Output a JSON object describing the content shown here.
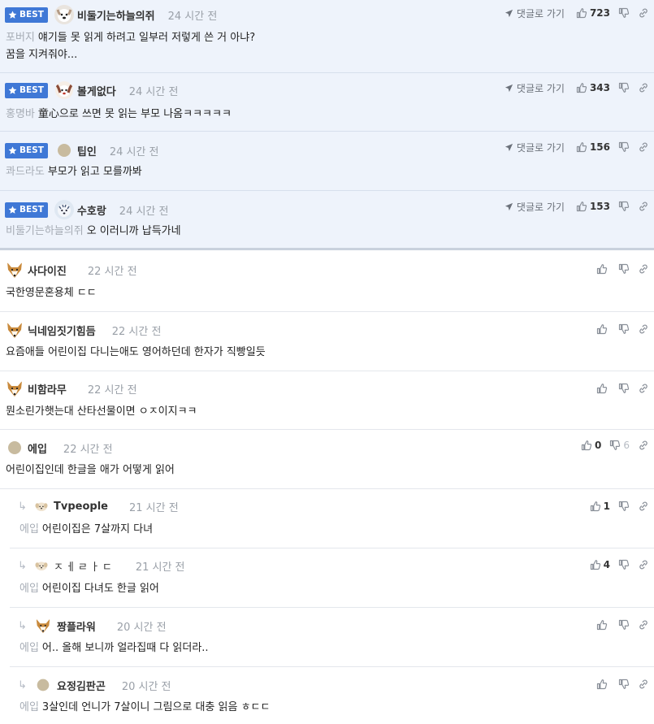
{
  "labels": {
    "best": "BEST",
    "goto_reply": "댓글로 가기"
  },
  "colors": {
    "best_bg": "#eef3fb",
    "badge": "#3f78d6",
    "muted": "#9aa0a8"
  },
  "best_comments": [
    {
      "nick": "비둘기는하늘의쥐",
      "time": "24 시간 전",
      "mention": "포버지",
      "text": "얘기들 못 읽게 하려고 일부러 저렇게 쓴 거 아냐?",
      "text2": "꿈을 지켜줘야...",
      "likes": "723",
      "avatar": "dog-white-icon"
    },
    {
      "nick": "볼게없다",
      "time": "24 시간 전",
      "mention": "홍명바",
      "text": "童心으로 쓰면 못 읽는 부모 나옴ㅋㅋㅋㅋㅋ",
      "likes": "343",
      "avatar": "dog-red-icon"
    },
    {
      "nick": "팁인",
      "time": "24 시간 전",
      "mention": "콰드라도",
      "text": "부모가 읽고 모를까봐",
      "likes": "156",
      "avatar": "default-avatar-icon"
    },
    {
      "nick": "수호랑",
      "time": "24 시간 전",
      "mention": "비둘기는하늘의쥐",
      "text": "오 이러니까 납득가네",
      "likes": "153",
      "avatar": "tiger-mascot-icon"
    }
  ],
  "comments": [
    {
      "nick": "사다이진",
      "time": "22 시간 전",
      "text": "국한영문혼용체 ㄷㄷ",
      "likes": "",
      "avatar": "fox-icon"
    },
    {
      "nick": "닉네임짓기힘듬",
      "time": "22 시간 전",
      "text": "요즘애들 어린이집 다니는애도 영어하던데 한자가 직빵일듯",
      "likes": "",
      "avatar": "fox-icon"
    },
    {
      "nick": "비함라무",
      "time": "22 시간 전",
      "text": "뭔소린가햇는대 산타선물이면 ㅇㅈ이지ㅋㅋ",
      "likes": "",
      "avatar": "fox-icon"
    },
    {
      "nick": "에입",
      "time": "22 시간 전",
      "text": "어린이집인데 한글을 애가 어떻게 읽어",
      "likes": "0",
      "dislikes": "6",
      "avatar": "default-avatar-icon"
    }
  ],
  "replies": [
    {
      "nick": "Tvpeople",
      "time": "21 시간 전",
      "mention": "에입",
      "text": "어린이집은 7살까지 다녀",
      "likes": "1",
      "avatar": "puppy-icon"
    },
    {
      "nick": "ㅈㅔㄹㅏㄷ",
      "time": "21 시간 전",
      "mention": "에입",
      "text": "어린이집 다녀도 한글 읽어",
      "likes": "4",
      "avatar": "puppy-icon"
    },
    {
      "nick": "짱플라워",
      "time": "20 시간 전",
      "mention": "에입",
      "text": "어.. 올해 보니까 얼라집때 다 읽더라..",
      "likes": "",
      "avatar": "fox-icon"
    },
    {
      "nick": "요정김판곤",
      "time": "20 시간 전",
      "mention": "에입",
      "text": "3살인데 언니가 7살이니 그림으로 대충 읽음 ㅎㄷㄷ",
      "likes": "",
      "avatar": "default-avatar-icon"
    }
  ]
}
